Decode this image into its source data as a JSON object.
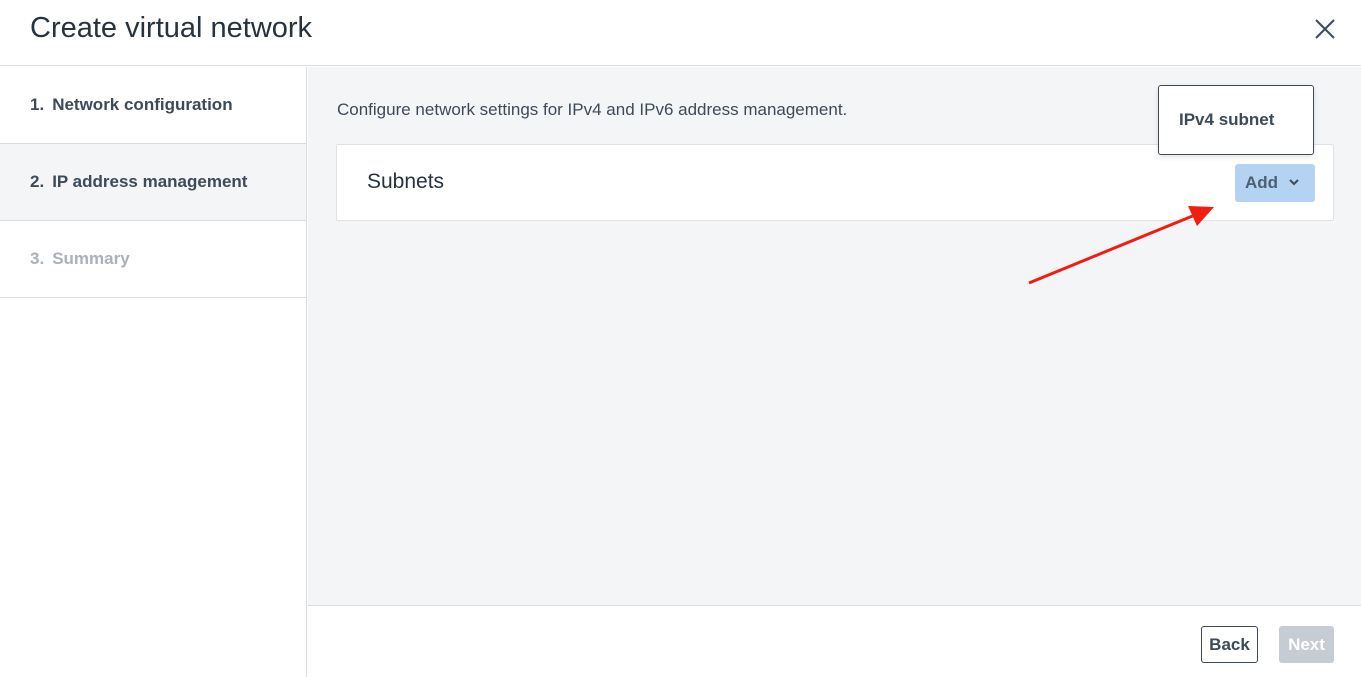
{
  "dialog": {
    "title": "Create virtual network"
  },
  "steps": [
    {
      "number": "1.",
      "label": "Network configuration",
      "state": "completed"
    },
    {
      "number": "2.",
      "label": "IP address management",
      "state": "active"
    },
    {
      "number": "3.",
      "label": "Summary",
      "state": "disabled"
    }
  ],
  "main": {
    "description": "Configure network settings for IPv4 and IPv6 address management.",
    "subnets_panel": {
      "title": "Subnets",
      "add_label": "Add"
    },
    "add_menu": {
      "options": [
        "IPv4 subnet"
      ]
    }
  },
  "footer": {
    "back_label": "Back",
    "next_label": "Next"
  },
  "icons": {
    "close": "close-icon",
    "add_dropdown": "chevron-down-icon"
  },
  "colors": {
    "annotation_arrow": "#f21d10",
    "add_button_bg": "#b4d3f2",
    "next_disabled_bg": "#c6ccd3"
  }
}
